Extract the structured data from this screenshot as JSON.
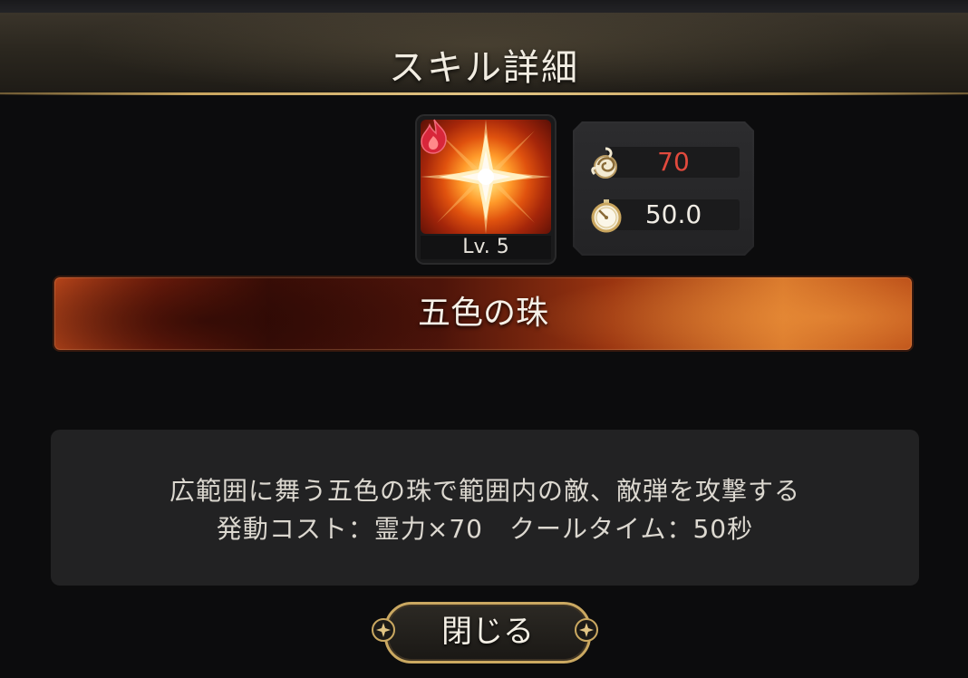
{
  "header": {
    "title": "スキル詳細"
  },
  "skill": {
    "level": "Lv. 5",
    "icon": "light-burst-icon",
    "element_icon": "fire-element-icon",
    "name": "五色の珠"
  },
  "stats": {
    "cost": {
      "icon": "spirit-power-icon",
      "value": "70",
      "color": "#e24a3d"
    },
    "cooldown": {
      "icon": "stopwatch-icon",
      "value": "50.0"
    }
  },
  "description": {
    "line1": "広範囲に舞う五色の珠で範囲内の敵、敵弾を攻撃する",
    "line2": "発動コスト：霊力×70　クールタイム：50秒"
  },
  "close_button": {
    "label": "閉じる"
  },
  "colors": {
    "accent_gold": "#caa861",
    "banner_red": "#9a3410"
  }
}
